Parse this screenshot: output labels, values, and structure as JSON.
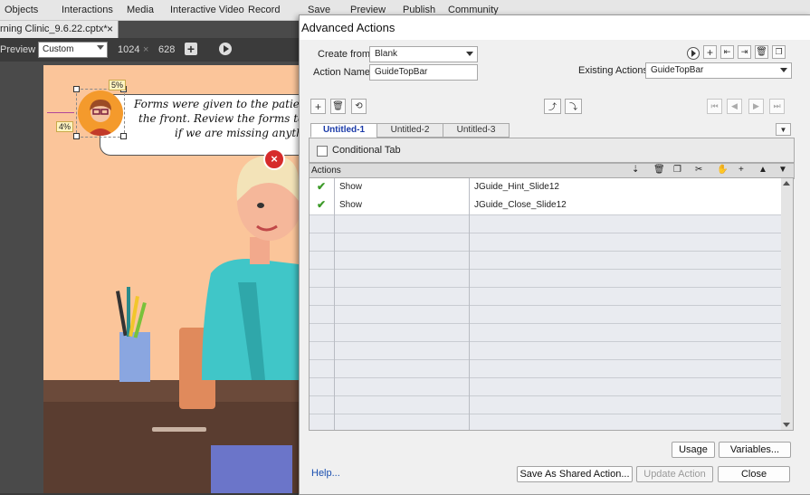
{
  "menubar": {
    "items": [
      "Objects",
      "Interactions",
      "Media",
      "Interactive Video",
      "Record",
      "Save",
      "Preview",
      "Publish",
      "Community"
    ]
  },
  "filetab": {
    "name": "rning Clinic_9.6.22.cptx*",
    "close": "×"
  },
  "toolbar": {
    "preview_label": "Preview",
    "size_preset": "Custom",
    "width": "1024",
    "times": "×",
    "height": "628",
    "right_edge": "24"
  },
  "slide": {
    "speech_text": [
      "Forms were given to the patient",
      "the front. Review the forms to s",
      "if we are missing anythi"
    ],
    "badge_top": "5%",
    "badge_left": "4%"
  },
  "dialog": {
    "title": "Advanced Actions",
    "create_from_label": "Create from:",
    "create_from_value": "Blank",
    "action_name_label": "Action Name:",
    "action_name_value": "GuideTopBar",
    "existing_actions_label": "Existing Actions:",
    "existing_actions_value": "GuideTopBar",
    "tabs": [
      "Untitled-1",
      "Untitled-2",
      "Untitled-3"
    ],
    "conditional_tab_label": "Conditional Tab",
    "actions_header": "Actions",
    "rows": [
      {
        "action": "Show",
        "target": "JGuide_Hint_Slide12"
      },
      {
        "action": "Show",
        "target": "JGuide_Close_Slide12"
      }
    ],
    "buttons": {
      "usage": "Usage",
      "variables": "Variables...",
      "help": "Help...",
      "save_shared": "Save As Shared Action...",
      "update": "Update Action",
      "close": "Close"
    }
  },
  "colors": {
    "slide_bg": "#fbc59a",
    "tab_active_text": "#1a3aa8",
    "check": "#3c9a28",
    "close_badge": "#d62b2b"
  }
}
